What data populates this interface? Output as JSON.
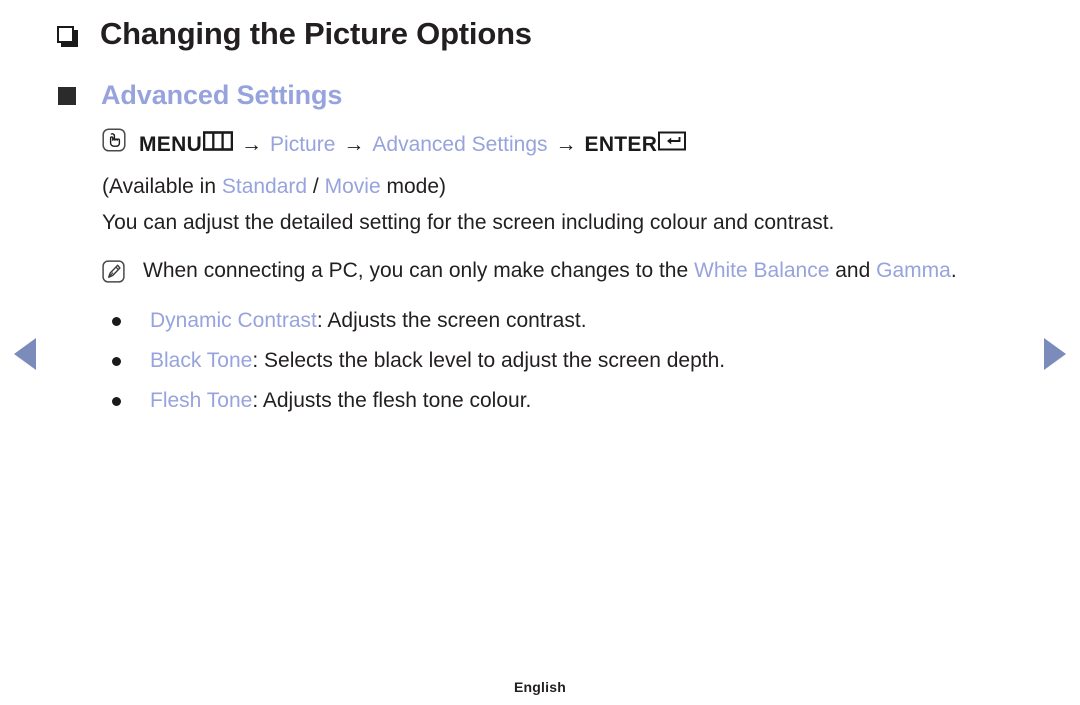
{
  "page": {
    "title": "Changing the Picture Options",
    "title_bullet_icon": "hollow-square-shadow-icon",
    "section": {
      "heading": "Advanced Settings",
      "heading_bullet_icon": "filled-square-icon",
      "menu_path": {
        "oo_icon": "hand-press-button-icon",
        "menu_label": "MENU",
        "menu_glyph_icon": "menu-grid-icon",
        "arrow": "→",
        "step_picture": "Picture",
        "step_advanced_settings": "Advanced Settings",
        "enter_label": "ENTER",
        "enter_glyph_icon": "enter-return-icon"
      },
      "availability": {
        "prefix": "(Available in ",
        "mode_1": "Standard",
        "separator": " / ",
        "mode_2": "Movie",
        "suffix": " mode)"
      },
      "description": "You can adjust the detailed setting for the screen including colour and contrast.",
      "note": {
        "nn_icon": "note-pencil-icon",
        "text_part_1": "When connecting a PC, you can only make changes to the ",
        "highlight_1": "White Balance",
        "text_part_2": " and ",
        "highlight_2": "Gamma",
        "text_part_3": "."
      },
      "options": [
        {
          "term": "Dynamic Contrast",
          "definition": ": Adjusts the screen contrast."
        },
        {
          "term": "Black Tone",
          "definition": ": Selects the black level to adjust the screen depth."
        },
        {
          "term": "Flesh Tone",
          "definition": ": Adjusts the flesh tone colour."
        }
      ]
    },
    "footer": "English",
    "nav": {
      "prev_icon": "triangle-left-icon",
      "next_icon": "triangle-right-icon"
    },
    "colors": {
      "accent_blue": "#97a3dd",
      "nav_arrow_blue": "#7c8cba",
      "text_black": "#231f20",
      "background": "#ffffff"
    }
  }
}
